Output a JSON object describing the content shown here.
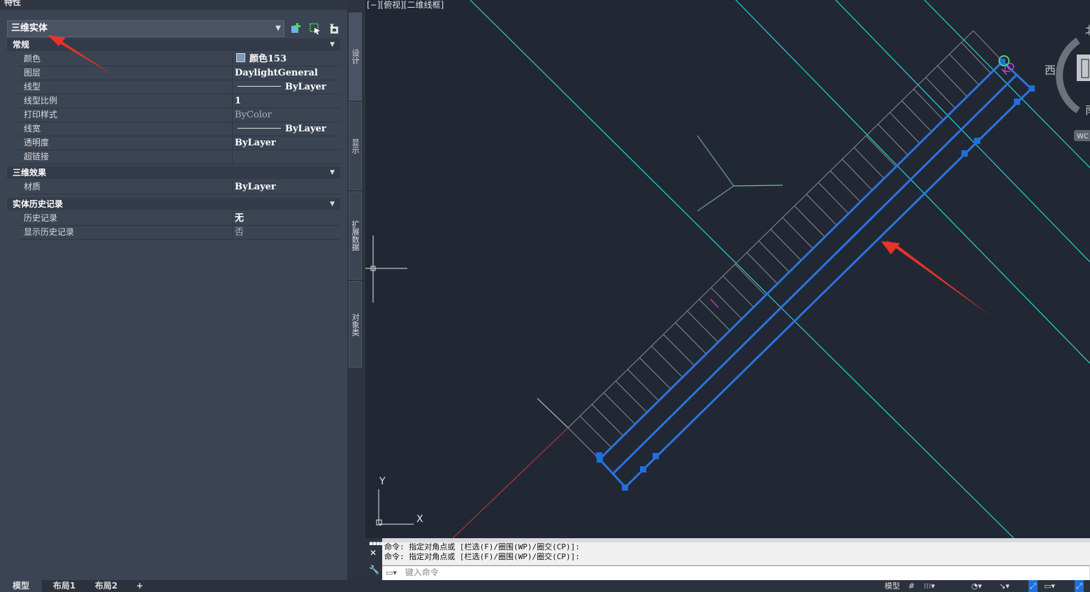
{
  "palette": {
    "title": "特性"
  },
  "selector": {
    "value": "三维实体"
  },
  "sections": {
    "general": "常规",
    "3d_effects": "三维效果",
    "solid_history": "实体历史记录"
  },
  "properties": {
    "color": {
      "label": "颜色",
      "value": "颜色153"
    },
    "layer": {
      "label": "图层",
      "value": "DaylightGeneral"
    },
    "linetype": {
      "label": "线型",
      "value": "ByLayer"
    },
    "ltscale": {
      "label": "线型比例",
      "value": "1"
    },
    "plotstyle": {
      "label": "打印样式",
      "value": "ByColor"
    },
    "lineweight": {
      "label": "线宽",
      "value": "ByLayer"
    },
    "transparency": {
      "label": "透明度",
      "value": "ByLayer"
    },
    "hyperlink": {
      "label": "超链接",
      "value": ""
    },
    "material": {
      "label": "材质",
      "value": "ByLayer"
    },
    "history": {
      "label": "历史记录",
      "value": "无"
    },
    "show_history": {
      "label": "显示历史记录",
      "value": "否"
    }
  },
  "side_tabs": [
    "设计",
    "显示",
    "扩展数据",
    "对象类"
  ],
  "viewport": {
    "label": "[−][俯视][二维线框]",
    "axis_y": "Y",
    "axis_x": "X"
  },
  "viewcube": {
    "north": "北",
    "west": "西",
    "south": "南",
    "wcs": "WC"
  },
  "command": {
    "history": [
      "命令: 指定对角点或 [栏选(F)/圈围(WP)/圈交(CP)]:",
      "命令: 指定对角点或 [栏选(F)/圈围(WP)/圈交(CP)]:"
    ],
    "placeholder": "键入命令"
  },
  "layout_tabs": [
    "模型",
    "布局1",
    "布局2",
    "+"
  ],
  "status": {
    "model": "模型"
  },
  "colors": {
    "accent_blue": "#1e6fd9",
    "cyan": "#1fd8d8",
    "red_arrow": "#e8332b"
  }
}
